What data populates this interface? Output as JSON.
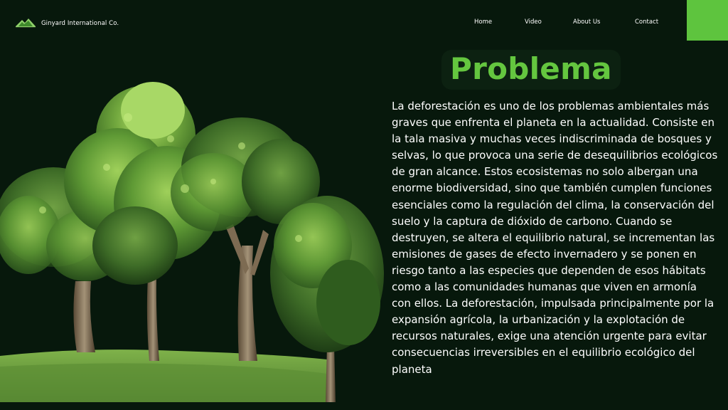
{
  "header": {
    "brand_name": "Ginyard International Co.",
    "logo_icon": "mountain-logo-icon",
    "nav": [
      {
        "label": "Home"
      },
      {
        "label": "Video"
      },
      {
        "label": "About Us"
      },
      {
        "label": "Contact"
      }
    ],
    "accent_color": "#5ec43e"
  },
  "main": {
    "title": "Problema",
    "title_color": "#64c63f",
    "body": "La deforestación es uno de los problemas ambientales más graves que enfrenta el planeta en la actualidad. Consiste en la tala masiva y muchas veces indiscriminada de bosques y selvas, lo que provoca una serie de desequilibrios ecológicos de gran alcance. Estos ecosistemas no solo albergan una enorme biodiversidad, sino que también cumplen funciones esenciales como la regulación del clima, la conservación del suelo y la captura de dióxido de carbono. Cuando se destruyen, se altera el equilibrio natural, se incrementan las emisiones de gases de efecto invernadero y se ponen en riesgo tanto a las especies que dependen de esos hábitats como a las comunidades humanas que viven en armonía con ellos. La deforestación, impulsada principalmente por la expansión agrícola, la urbanización y la explotación de recursos naturales, exige una atención urgente para evitar consecuencias irreversibles en el equilibrio ecológico del planeta"
  },
  "colors": {
    "background": "#07180c",
    "text": "#ffffff"
  }
}
